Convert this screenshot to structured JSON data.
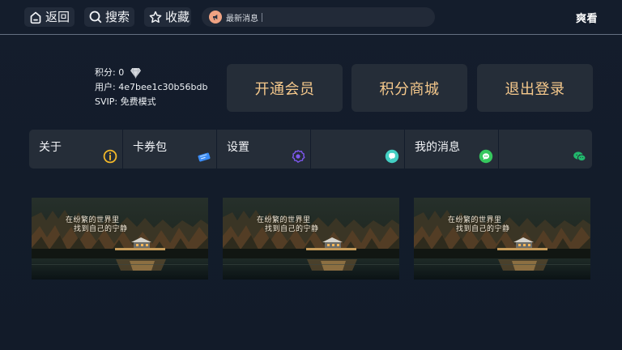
{
  "app": {
    "brand": "爽看"
  },
  "header": {
    "buttons": [
      {
        "label": "返回",
        "icon": "home-icon"
      },
      {
        "label": "搜索",
        "icon": "search-icon"
      },
      {
        "label": "收藏",
        "icon": "star-icon"
      }
    ],
    "notice": {
      "label": "最新消息",
      "icon": "megaphone-icon"
    }
  },
  "user": {
    "points_line": "积分: 0",
    "user_line": "用户: 4e7bee1c30b56bdb",
    "svip_line": "SVIP: 免费模式"
  },
  "actions": [
    {
      "label": "开通会员"
    },
    {
      "label": "积分商城"
    },
    {
      "label": "退出登录"
    }
  ],
  "menu": [
    {
      "label": "关于",
      "icon": "info-icon",
      "color": "#f2b829"
    },
    {
      "label": "卡券包",
      "icon": "coupon-icon",
      "color": "#3b8cf6"
    },
    {
      "label": "设置",
      "icon": "gear-icon",
      "color": "#7e58ef"
    },
    {
      "label": "",
      "icon": "chat-bubble-icon",
      "color": "#43cfc3"
    },
    {
      "label": "我的消息",
      "icon": "message-icon",
      "color": "#36c85e"
    },
    {
      "label": "",
      "icon": "wechat-icon",
      "color": "#21b96c"
    }
  ],
  "gallery": {
    "caption_line_1": "在纷繁的世界里",
    "caption_line_2": "找到自己的宁静",
    "cards": 3
  },
  "colors": {
    "background": "#121b2a",
    "panel": "#252d38",
    "accent_gold": "#f6c98c"
  }
}
